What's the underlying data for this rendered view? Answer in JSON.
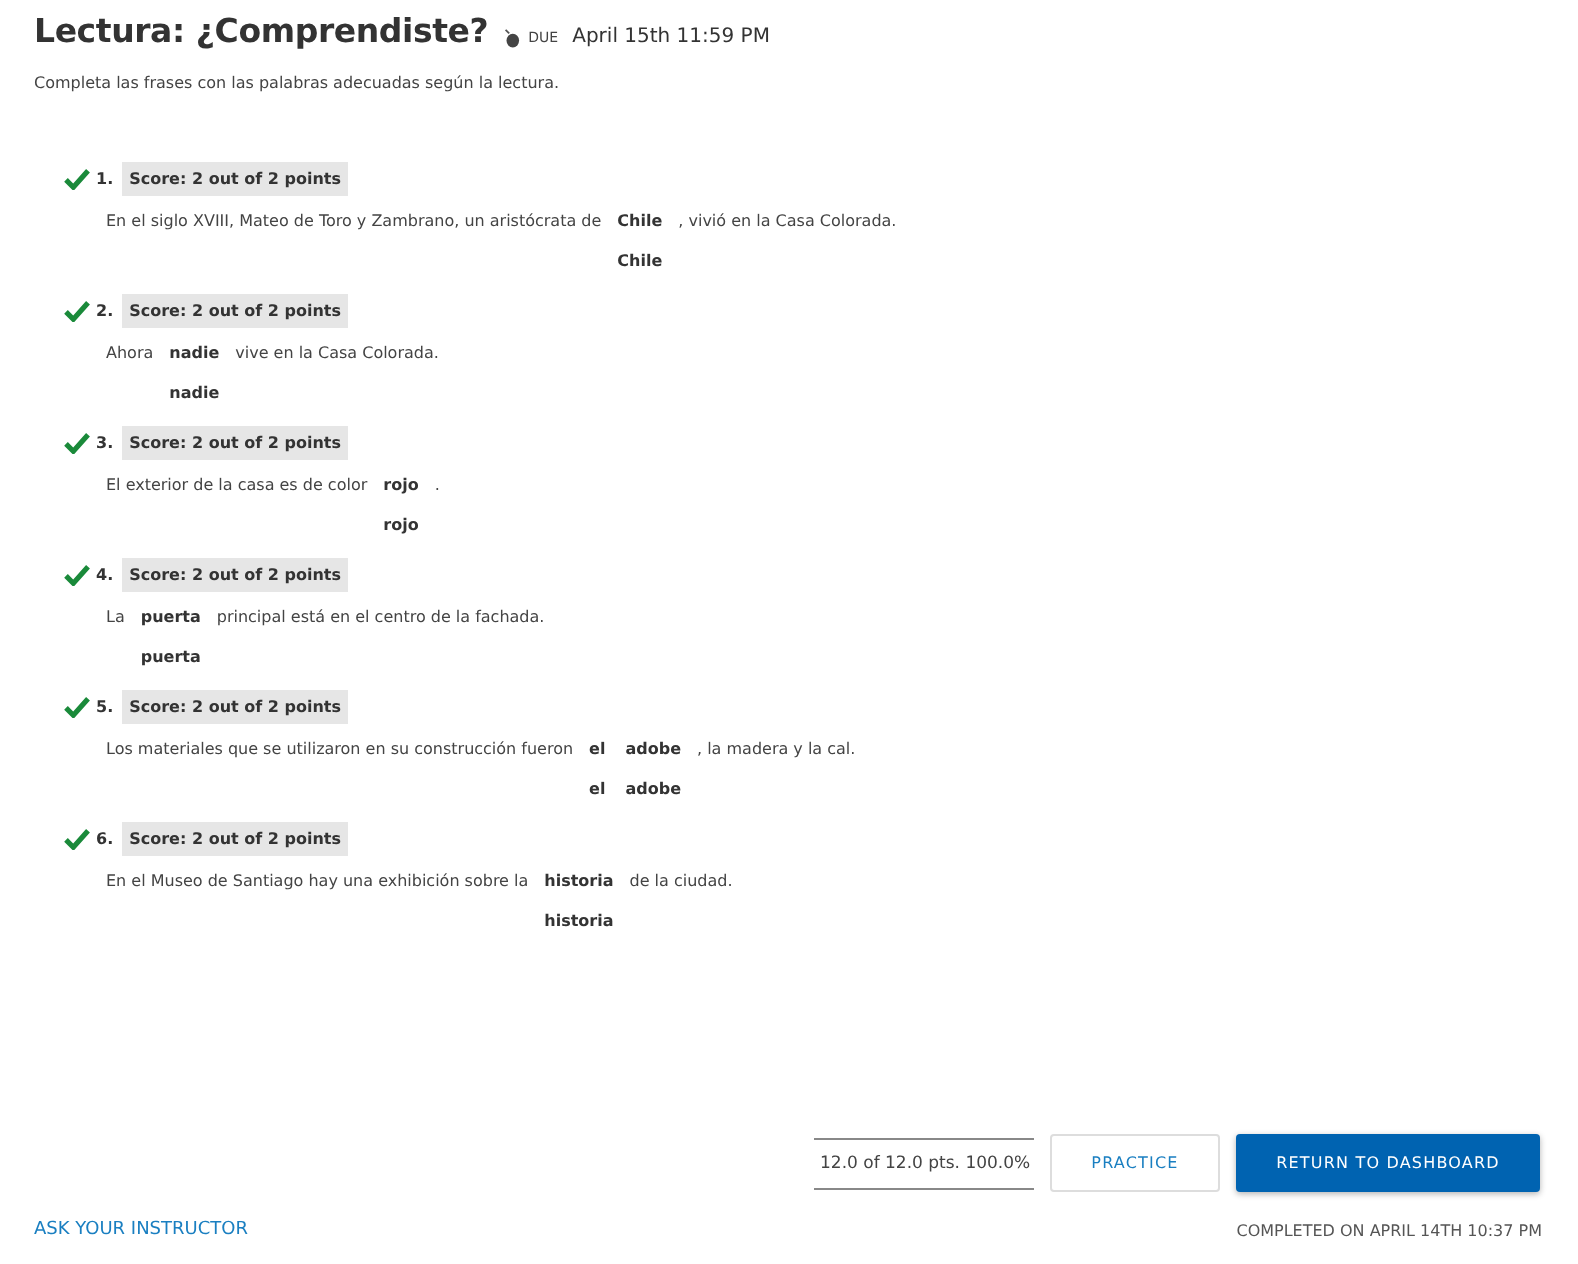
{
  "title": "Lectura: ¿Comprendiste?",
  "due": {
    "label": "DUE",
    "date": "April 15th 11:59 PM"
  },
  "instructions": "Completa las frases con las palabras adecuadas según la lectura.",
  "questions": [
    {
      "number": "1.",
      "correct": true,
      "score": "Score: 2 out of 2 points",
      "parts": [
        {
          "kind": "text",
          "text": "En el siglo XVIII, Mateo de Toro y Zambrano, un aristócrata de"
        },
        {
          "kind": "blank",
          "answer": "Chile",
          "key": "Chile"
        },
        {
          "kind": "text",
          "text": ", vivió en la Casa Colorada."
        }
      ]
    },
    {
      "number": "2.",
      "correct": true,
      "score": "Score: 2 out of 2 points",
      "parts": [
        {
          "kind": "text",
          "text": "Ahora"
        },
        {
          "kind": "blank",
          "answer": "nadie",
          "key": "nadie"
        },
        {
          "kind": "text",
          "text": "vive en la Casa Colorada."
        }
      ]
    },
    {
      "number": "3.",
      "correct": true,
      "score": "Score: 2 out of 2 points",
      "parts": [
        {
          "kind": "text",
          "text": "El exterior de la casa es de color"
        },
        {
          "kind": "blank",
          "answer": "rojo",
          "key": "rojo"
        },
        {
          "kind": "text",
          "text": "."
        }
      ]
    },
    {
      "number": "4.",
      "correct": true,
      "score": "Score: 2 out of 2 points",
      "parts": [
        {
          "kind": "text",
          "text": "La"
        },
        {
          "kind": "blank",
          "answer": "puerta",
          "key": "puerta"
        },
        {
          "kind": "text",
          "text": "principal está en el centro de la fachada."
        }
      ]
    },
    {
      "number": "5.",
      "correct": true,
      "score": "Score: 2 out of 2 points",
      "parts": [
        {
          "kind": "text",
          "text": "Los materiales que se utilizaron en su construcción fueron"
        },
        {
          "kind": "blank",
          "answer": "el",
          "key": "el"
        },
        {
          "kind": "blank",
          "answer": "adobe",
          "key": "adobe"
        },
        {
          "kind": "text",
          "text": ", la madera y la cal."
        }
      ]
    },
    {
      "number": "6.",
      "correct": true,
      "score": "Score: 2 out of 2 points",
      "parts": [
        {
          "kind": "text",
          "text": "En el Museo de Santiago hay una exhibición sobre la"
        },
        {
          "kind": "blank",
          "answer": "historia",
          "key": "historia"
        },
        {
          "kind": "text",
          "text": "de la ciudad."
        }
      ]
    }
  ],
  "total": "12.0 of 12.0 pts. 100.0%",
  "buttons": [
    {
      "kind": "secondary",
      "label": "PRACTICE"
    },
    {
      "kind": "primary",
      "label": "RETURN TO DASHBOARD"
    }
  ],
  "ask_link": "ASK YOUR INSTRUCTOR",
  "completed": "COMPLETED ON APRIL 14TH 10:37 PM"
}
